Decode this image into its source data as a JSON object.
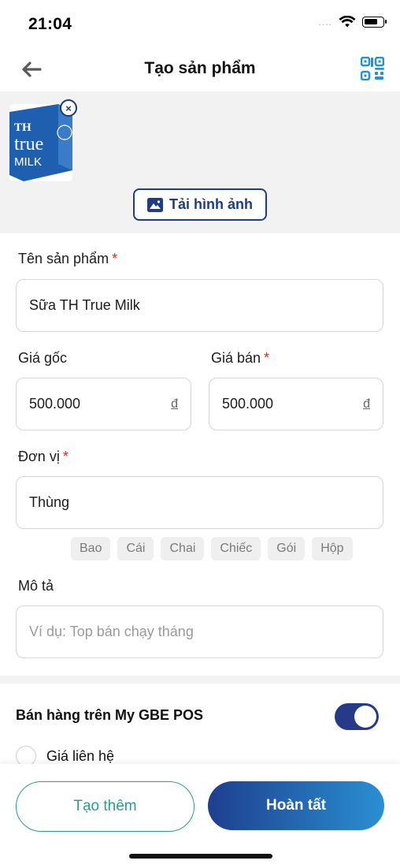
{
  "status_bar": {
    "time": "21:04",
    "signal": "....",
    "icons": [
      "wifi-icon",
      "battery-icon"
    ]
  },
  "header": {
    "title": "Tạo sản phẩm",
    "back_icon": "arrow-left-icon",
    "qr_icon": "qr-code-icon"
  },
  "images": {
    "thumbnail_text": [
      "TH",
      "true",
      "MILK"
    ],
    "remove_label": "×",
    "upload_label": "Tải hình ảnh"
  },
  "form": {
    "name": {
      "label": "Tên sản phẩm",
      "required": "*",
      "value": "Sữa TH True Milk"
    },
    "original_price": {
      "label": "Giá gốc",
      "value": "500.000",
      "currency": "đ"
    },
    "sale_price": {
      "label": "Giá bán",
      "required": "*",
      "value": "500.000",
      "currency": "đ"
    },
    "unit": {
      "label": "Đơn vị",
      "required": "*",
      "value": "Thùng"
    },
    "unit_chips": [
      "Bao",
      "Cái",
      "Chai",
      "Chiếc",
      "Gói",
      "Hộp"
    ],
    "description": {
      "label": "Mô tả",
      "placeholder": "Ví dụ: Top bán chạy tháng"
    }
  },
  "selling": {
    "label": "Bán hàng trên My GBE POS",
    "toggle_on": true,
    "contact_price_label": "Giá liên hệ"
  },
  "footer": {
    "secondary_label": "Tạo thêm",
    "primary_label": "Hoàn tất"
  },
  "colors": {
    "primary": "#1e3d85",
    "accent_teal": "#2a9d8f",
    "required": "#e02424",
    "qr": "#2a8fd1"
  }
}
